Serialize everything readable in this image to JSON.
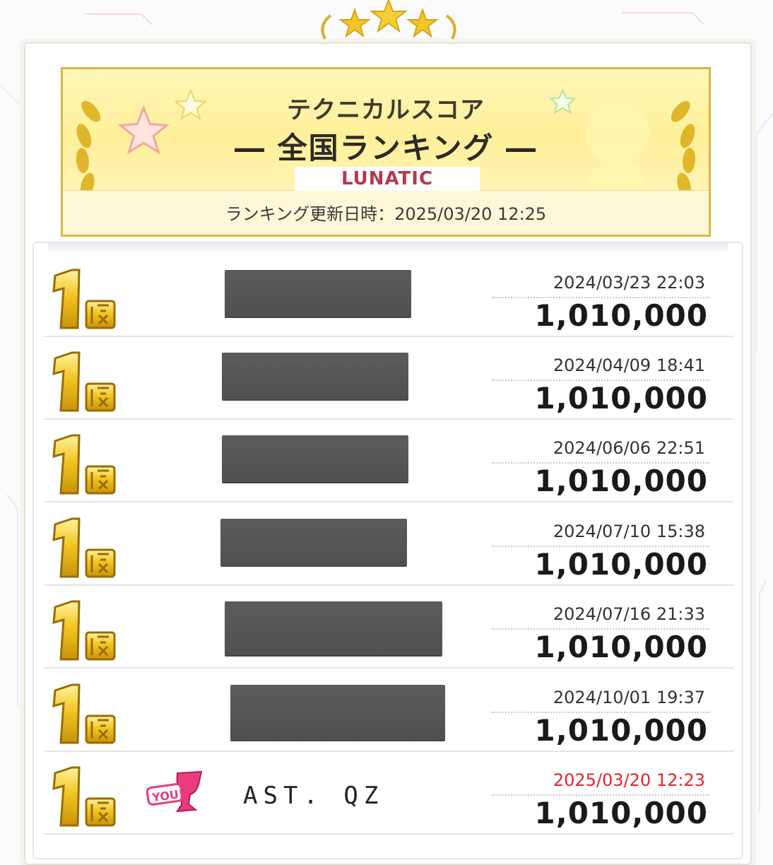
{
  "banner": {
    "subtitle": "テクニカルスコア",
    "title": "― 全国ランキング ―",
    "difficulty": "LUNATIC",
    "updated": "ランキング更新日時：2025/03/20 12:25"
  },
  "rank_icon": "rank-1st-icon",
  "rows": [
    {
      "rank": "1位",
      "name": "",
      "date": "2024/03/23 22:03",
      "score": "1,010,000"
    },
    {
      "rank": "1位",
      "name": "",
      "date": "2024/04/09 18:41",
      "score": "1,010,000"
    },
    {
      "rank": "1位",
      "name": "",
      "date": "2024/06/06 22:51",
      "score": "1,010,000"
    },
    {
      "rank": "1位",
      "name": "",
      "date": "2024/07/10 15:38",
      "score": "1,010,000"
    },
    {
      "rank": "1位",
      "name": "",
      "date": "2024/07/16 21:33",
      "score": "1,010,000"
    },
    {
      "rank": "1位",
      "name": "",
      "date": "2024/10/01 19:37",
      "score": "1,010,000"
    },
    {
      "rank": "1位",
      "name": "AST. QZ",
      "date": "2025/03/20 12:23",
      "score": "1,010,000",
      "you": "YOU!"
    }
  ],
  "colors": {
    "gold": "#e8b820",
    "highlight_date": "#e0262e",
    "name_mask": "#555555"
  }
}
